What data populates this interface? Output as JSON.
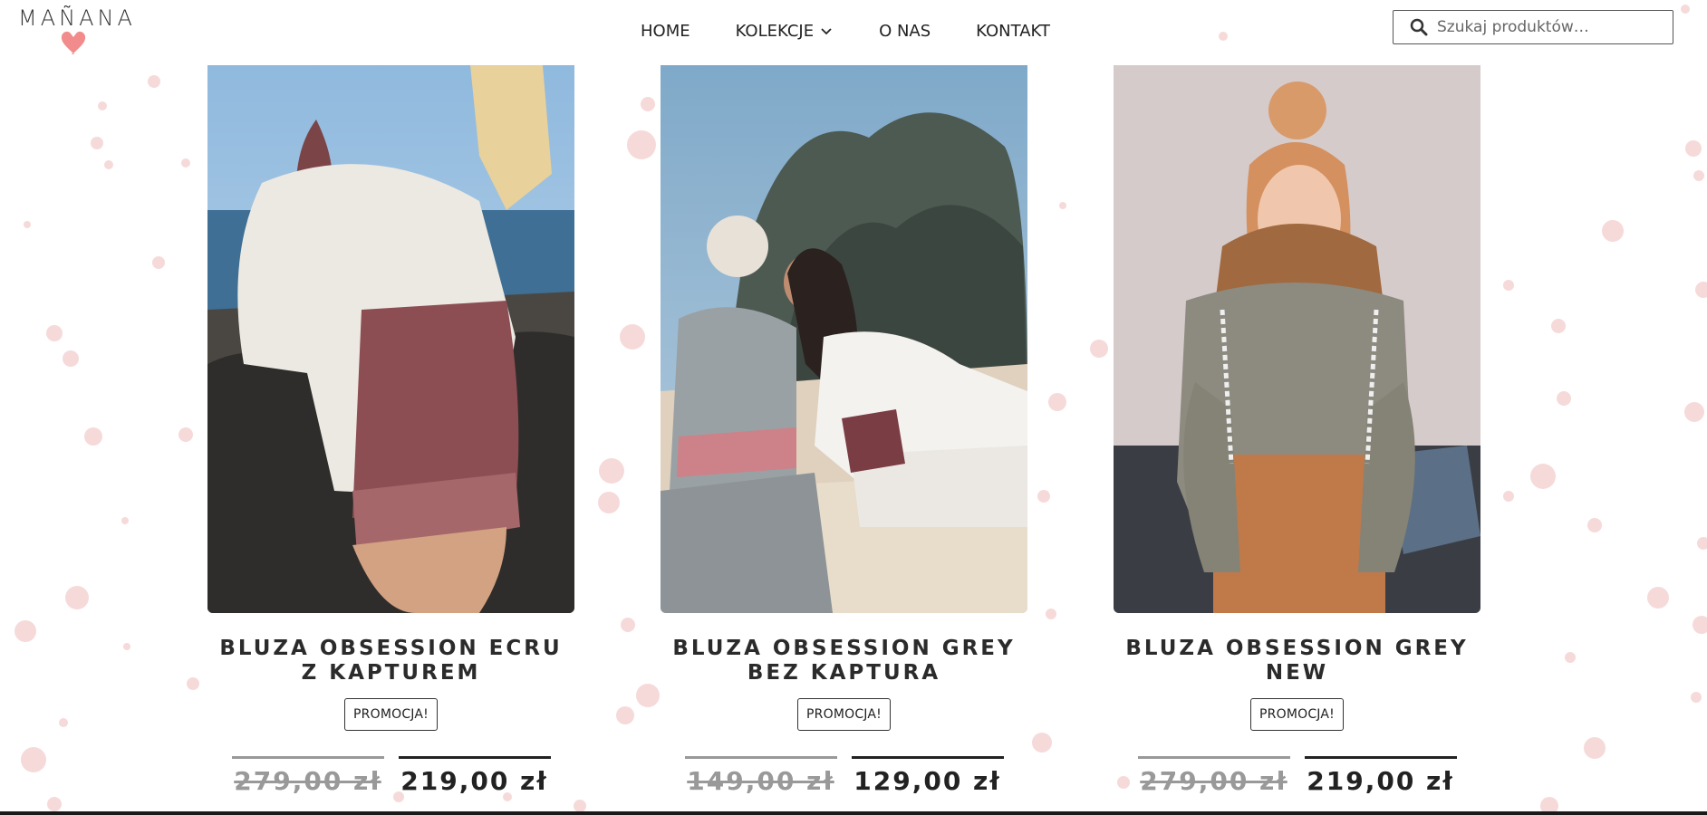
{
  "header": {
    "logo_text": "MAÑANA",
    "nav": [
      {
        "label": "HOME"
      },
      {
        "label": "KOLEKCJE",
        "has_dropdown": true
      },
      {
        "label": "O NAS"
      },
      {
        "label": "KONTAKT"
      }
    ],
    "search": {
      "placeholder": "Szukaj produktów…",
      "value": ""
    }
  },
  "colors": {
    "dot": "#f6dada",
    "heart": "#f28b8b",
    "old_price": "#999999"
  },
  "products": [
    {
      "title": "BLUZA OBSESSION ECRU Z KAPTUREM",
      "badge": "PROMOCJA!",
      "old_price": "279,00 zł",
      "new_price": "219,00 zł"
    },
    {
      "title": "BLUZA OBSESSION GREY BEZ KAPTURA",
      "badge": "PROMOCJA!",
      "old_price": "149,00 zł",
      "new_price": "129,00 zł"
    },
    {
      "title": "BLUZA OBSESSION GREY NEW",
      "badge": "PROMOCJA!",
      "old_price": "279,00 zł",
      "new_price": "219,00 zł"
    }
  ]
}
